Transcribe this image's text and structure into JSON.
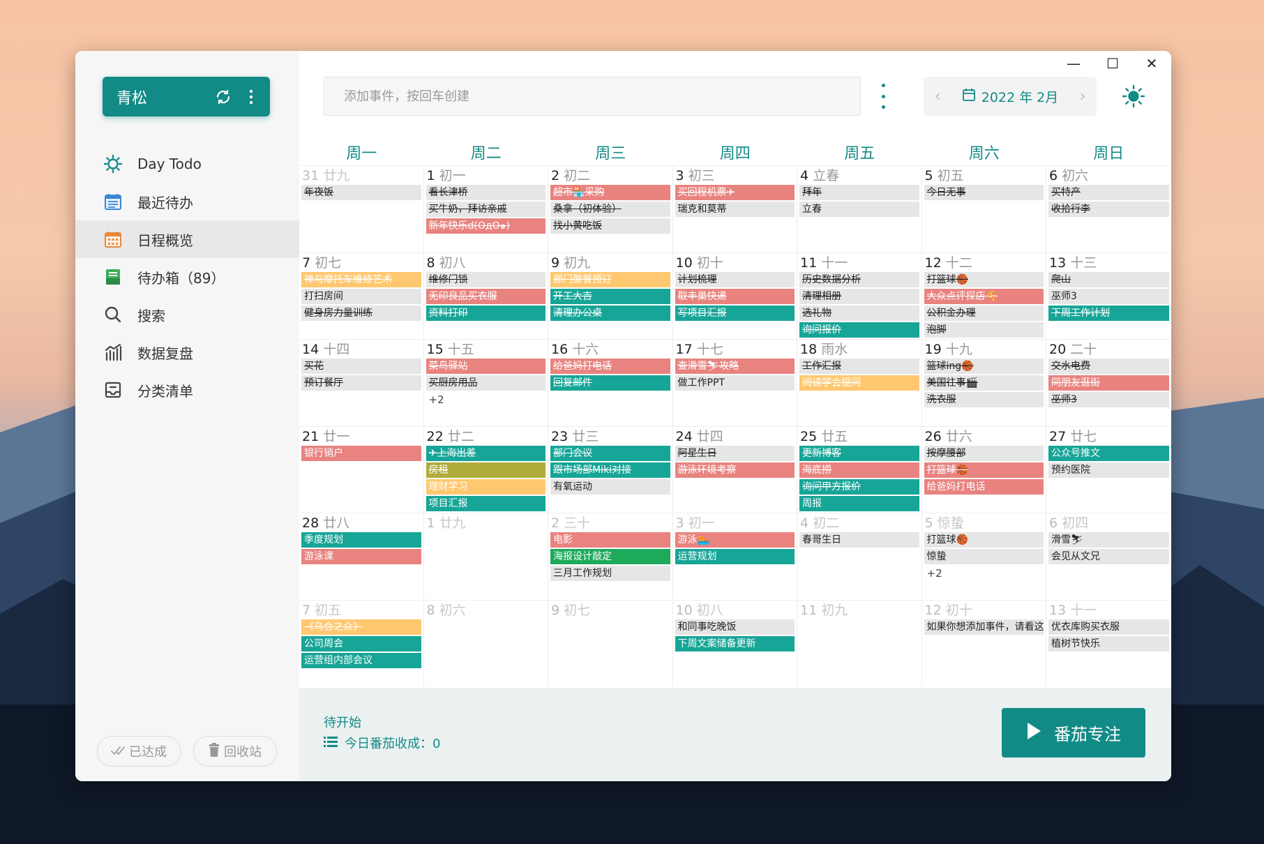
{
  "colors": {
    "accent": "#128a86",
    "red": "#e8837f",
    "teal": "#17a597",
    "yellow": "#ffc870",
    "olive": "#b0ac3a",
    "green": "#1eaa5b",
    "grey": "#e6e6e6"
  },
  "sidebar": {
    "account_name": "青松",
    "account_icons": [
      "sync-icon",
      "more-vertical-icon"
    ],
    "nav": [
      {
        "label": "Day Todo",
        "icon": "sun-icon"
      },
      {
        "label": "最近待办",
        "icon": "calendar-list-icon"
      },
      {
        "label": "日程概览",
        "icon": "calendar-grid-icon",
        "active": true
      },
      {
        "label": "待办箱（89）",
        "icon": "inbox-icon"
      },
      {
        "label": "搜索",
        "icon": "search-icon"
      },
      {
        "label": "数据复盘",
        "icon": "bar-chart-icon"
      },
      {
        "label": "分类清单",
        "icon": "category-list-icon"
      }
    ],
    "achieved_label": "已达成",
    "trash_label": "回收站"
  },
  "toolbar": {
    "search_placeholder": "添加事件，按回车创建",
    "month_label": "2022 年 2月"
  },
  "window_controls": {
    "minimize": "—",
    "maximize": "☐",
    "close": "✕"
  },
  "calendar": {
    "weekdays": [
      "周一",
      "周二",
      "周三",
      "周四",
      "周五",
      "周六",
      "周日"
    ],
    "weeks": [
      [
        {
          "d": "31",
          "l": "廿九",
          "other": true,
          "events": [
            {
              "t": "年夜饭",
              "c": "grey",
              "done": true
            }
          ]
        },
        {
          "d": "1",
          "l": "初一",
          "events": [
            {
              "t": "看长津桥",
              "c": "grey",
              "done": true
            },
            {
              "t": "买牛奶，拜访亲戚",
              "c": "grey",
              "done": true
            },
            {
              "t": "新年快乐d(OдO๑)",
              "c": "red",
              "done": true
            }
          ]
        },
        {
          "d": "2",
          "l": "初二",
          "events": [
            {
              "t": "超市🏪采购",
              "c": "red",
              "done": true
            },
            {
              "t": "桑拿（初体验）",
              "c": "grey",
              "done": true
            },
            {
              "t": "找小黄吃饭",
              "c": "grey",
              "done": true
            }
          ]
        },
        {
          "d": "3",
          "l": "初三",
          "events": [
            {
              "t": "买回程机票✈",
              "c": "red",
              "done": true
            },
            {
              "t": "瑞克和莫蒂",
              "c": "grey",
              "done": false
            }
          ]
        },
        {
          "d": "4",
          "l": "立春",
          "events": [
            {
              "t": "拜年",
              "c": "grey",
              "done": true
            },
            {
              "t": "立春",
              "c": "grey",
              "done": false
            }
          ]
        },
        {
          "d": "5",
          "l": "初五",
          "events": [
            {
              "t": "今日无事",
              "c": "grey",
              "done": true
            }
          ]
        },
        {
          "d": "6",
          "l": "初六",
          "events": [
            {
              "t": "买特产",
              "c": "grey",
              "done": true
            },
            {
              "t": "收拾行李",
              "c": "grey",
              "done": true
            }
          ]
        }
      ],
      [
        {
          "d": "7",
          "l": "初七",
          "events": [
            {
              "t": "禅与摩托车维修艺术",
              "c": "yellow",
              "done": true
            },
            {
              "t": "打扫房间",
              "c": "grey",
              "done": false
            },
            {
              "t": "健身房力量训练",
              "c": "grey",
              "done": true
            }
          ]
        },
        {
          "d": "8",
          "l": "初八",
          "events": [
            {
              "t": "维修门锁",
              "c": "grey",
              "done": true
            },
            {
              "t": "无印良品买衣服",
              "c": "red",
              "done": true
            },
            {
              "t": "资料打印",
              "c": "teal",
              "done": true
            }
          ]
        },
        {
          "d": "9",
          "l": "初九",
          "events": [
            {
              "t": "部门聚餐预订",
              "c": "yellow",
              "done": true
            },
            {
              "t": "开工大吉",
              "c": "teal",
              "done": true
            },
            {
              "t": "清理办公桌",
              "c": "teal",
              "done": true
            }
          ]
        },
        {
          "d": "10",
          "l": "初十",
          "events": [
            {
              "t": "计划梳理",
              "c": "grey",
              "done": true
            },
            {
              "t": "取丰巢快递",
              "c": "red",
              "done": true
            },
            {
              "t": "写项目汇报",
              "c": "teal",
              "done": true
            }
          ]
        },
        {
          "d": "11",
          "l": "十一",
          "events": [
            {
              "t": "历史数据分析",
              "c": "grey",
              "done": true
            },
            {
              "t": "清理相册",
              "c": "grey",
              "done": true
            },
            {
              "t": "选礼物",
              "c": "grey",
              "done": true
            },
            {
              "t": "询问报价",
              "c": "teal",
              "done": true
            }
          ]
        },
        {
          "d": "12",
          "l": "十二",
          "events": [
            {
              "t": "打篮球🏀",
              "c": "grey",
              "done": true
            },
            {
              "t": "大众点评探店🍕",
              "c": "red",
              "done": true
            },
            {
              "t": "公积金办理",
              "c": "grey",
              "done": true
            },
            {
              "t": "泡脚",
              "c": "grey",
              "done": true
            }
          ]
        },
        {
          "d": "13",
          "l": "十三",
          "events": [
            {
              "t": "爬山",
              "c": "grey",
              "done": true
            },
            {
              "t": "巫师3",
              "c": "grey",
              "done": false
            },
            {
              "t": "下周工作计划",
              "c": "teal",
              "done": true
            }
          ]
        }
      ],
      [
        {
          "d": "14",
          "l": "十四",
          "events": [
            {
              "t": "买花",
              "c": "grey",
              "done": true
            },
            {
              "t": "预订餐厅",
              "c": "grey",
              "done": true
            }
          ]
        },
        {
          "d": "15",
          "l": "十五",
          "events": [
            {
              "t": "菜鸟驿站",
              "c": "red",
              "done": true
            },
            {
              "t": "买厨房用品",
              "c": "grey",
              "done": true
            }
          ],
          "more": "+2"
        },
        {
          "d": "16",
          "l": "十六",
          "events": [
            {
              "t": "给爸妈打电话",
              "c": "red",
              "done": true
            },
            {
              "t": "回复邮件",
              "c": "teal",
              "done": true
            }
          ]
        },
        {
          "d": "17",
          "l": "十七",
          "events": [
            {
              "t": "查滑雪⛷攻略",
              "c": "red",
              "done": true
            },
            {
              "t": "做工作PPT",
              "c": "grey",
              "done": false
            }
          ]
        },
        {
          "d": "18",
          "l": "雨水",
          "events": [
            {
              "t": "工作汇报",
              "c": "grey",
              "done": true
            },
            {
              "t": "阅读学会提问",
              "c": "yellow",
              "done": true
            }
          ]
        },
        {
          "d": "19",
          "l": "十九",
          "events": [
            {
              "t": "篮球ing🏀",
              "c": "grey",
              "done": true
            },
            {
              "t": "美国往事🎬",
              "c": "grey",
              "done": true
            },
            {
              "t": "洗衣服",
              "c": "grey",
              "done": true
            }
          ]
        },
        {
          "d": "20",
          "l": "二十",
          "events": [
            {
              "t": "交水电费",
              "c": "grey",
              "done": true
            },
            {
              "t": "同朋友逛街",
              "c": "red",
              "done": true
            },
            {
              "t": "巫师3",
              "c": "grey",
              "done": true
            }
          ]
        }
      ],
      [
        {
          "d": "21",
          "l": "廿一",
          "events": [
            {
              "t": "银行销户",
              "c": "red",
              "done": false
            }
          ]
        },
        {
          "d": "22",
          "l": "廿二",
          "events": [
            {
              "t": "✈上海出差",
              "c": "teal",
              "done": true
            },
            {
              "t": "房租",
              "c": "olive",
              "done": true
            },
            {
              "t": "理财学习",
              "c": "yellow",
              "done": false
            },
            {
              "t": "项目汇报",
              "c": "teal",
              "done": false
            }
          ]
        },
        {
          "d": "23",
          "l": "廿三",
          "events": [
            {
              "t": "部门会议",
              "c": "teal",
              "done": true
            },
            {
              "t": "跟市场部Miki对接",
              "c": "teal",
              "done": true
            },
            {
              "t": "有氧运动",
              "c": "grey",
              "done": false
            }
          ]
        },
        {
          "d": "24",
          "l": "廿四",
          "events": [
            {
              "t": "阿星生日",
              "c": "grey",
              "done": true
            },
            {
              "t": "游泳环境考察",
              "c": "red",
              "done": true
            }
          ]
        },
        {
          "d": "25",
          "l": "廿五",
          "events": [
            {
              "t": "更新博客",
              "c": "teal",
              "done": true
            },
            {
              "t": "海底捞",
              "c": "red",
              "done": true
            },
            {
              "t": "询问甲方报价",
              "c": "teal",
              "done": true
            },
            {
              "t": "周报",
              "c": "teal",
              "done": false
            }
          ]
        },
        {
          "d": "26",
          "l": "廿六",
          "events": [
            {
              "t": "按摩腰部",
              "c": "grey",
              "done": true
            },
            {
              "t": "打篮球🏀",
              "c": "red",
              "done": true
            },
            {
              "t": "给爸妈打电话",
              "c": "red",
              "done": false
            }
          ]
        },
        {
          "d": "27",
          "l": "廿七",
          "events": [
            {
              "t": "公众号推文",
              "c": "teal",
              "done": false
            },
            {
              "t": "预约医院",
              "c": "grey",
              "done": false
            }
          ]
        }
      ],
      [
        {
          "d": "28",
          "l": "廿八",
          "events": [
            {
              "t": "季度规划",
              "c": "teal",
              "done": false
            },
            {
              "t": "游泳课",
              "c": "red",
              "done": false
            }
          ]
        },
        {
          "d": "1",
          "l": "廿九",
          "other": true,
          "events": []
        },
        {
          "d": "2",
          "l": "三十",
          "other": true,
          "events": [
            {
              "t": "电影",
              "c": "red",
              "done": false
            },
            {
              "t": "海报设计敲定",
              "c": "green",
              "done": false
            },
            {
              "t": "三月工作规划",
              "c": "grey",
              "done": false
            }
          ]
        },
        {
          "d": "3",
          "l": "初一",
          "other": true,
          "events": [
            {
              "t": "游泳🏊",
              "c": "red",
              "done": false
            },
            {
              "t": "运营规划",
              "c": "teal",
              "done": false
            }
          ]
        },
        {
          "d": "4",
          "l": "初二",
          "other": true,
          "events": [
            {
              "t": "春哥生日",
              "c": "grey",
              "done": false
            }
          ]
        },
        {
          "d": "5",
          "l": "惊蛰",
          "other": true,
          "events": [
            {
              "t": "打篮球🏀",
              "c": "grey",
              "done": false
            },
            {
              "t": "惊蛰",
              "c": "grey",
              "done": false
            }
          ],
          "more": "+2"
        },
        {
          "d": "6",
          "l": "初四",
          "other": true,
          "events": [
            {
              "t": "滑雪⛷",
              "c": "grey",
              "done": false
            },
            {
              "t": "会见从文兄",
              "c": "grey",
              "done": false
            }
          ]
        }
      ],
      [
        {
          "d": "7",
          "l": "初五",
          "other": true,
          "events": [
            {
              "t": "《乌合之众》",
              "c": "yellow",
              "done": true
            },
            {
              "t": "公司周会",
              "c": "teal",
              "done": false
            },
            {
              "t": "运营组内部会议",
              "c": "teal",
              "done": false
            }
          ]
        },
        {
          "d": "8",
          "l": "初六",
          "other": true,
          "events": []
        },
        {
          "d": "9",
          "l": "初七",
          "other": true,
          "events": []
        },
        {
          "d": "10",
          "l": "初八",
          "other": true,
          "events": [
            {
              "t": "和同事吃晚饭",
              "c": "grey",
              "done": false
            },
            {
              "t": "下周文案储备更新",
              "c": "teal",
              "done": false
            }
          ]
        },
        {
          "d": "11",
          "l": "初九",
          "other": true,
          "events": []
        },
        {
          "d": "12",
          "l": "初十",
          "other": true,
          "events": [
            {
              "t": "如果你想添加事件，请看这里",
              "c": "grey",
              "done": false
            }
          ]
        },
        {
          "d": "13",
          "l": "十一",
          "other": true,
          "events": [
            {
              "t": "优衣库购买衣服",
              "c": "grey",
              "done": false
            },
            {
              "t": "植树节快乐",
              "c": "grey",
              "done": false
            }
          ]
        }
      ]
    ]
  },
  "bottom": {
    "status": "待开始",
    "today_count": "今日番茄收成：0",
    "focus_label": "番茄专注"
  }
}
